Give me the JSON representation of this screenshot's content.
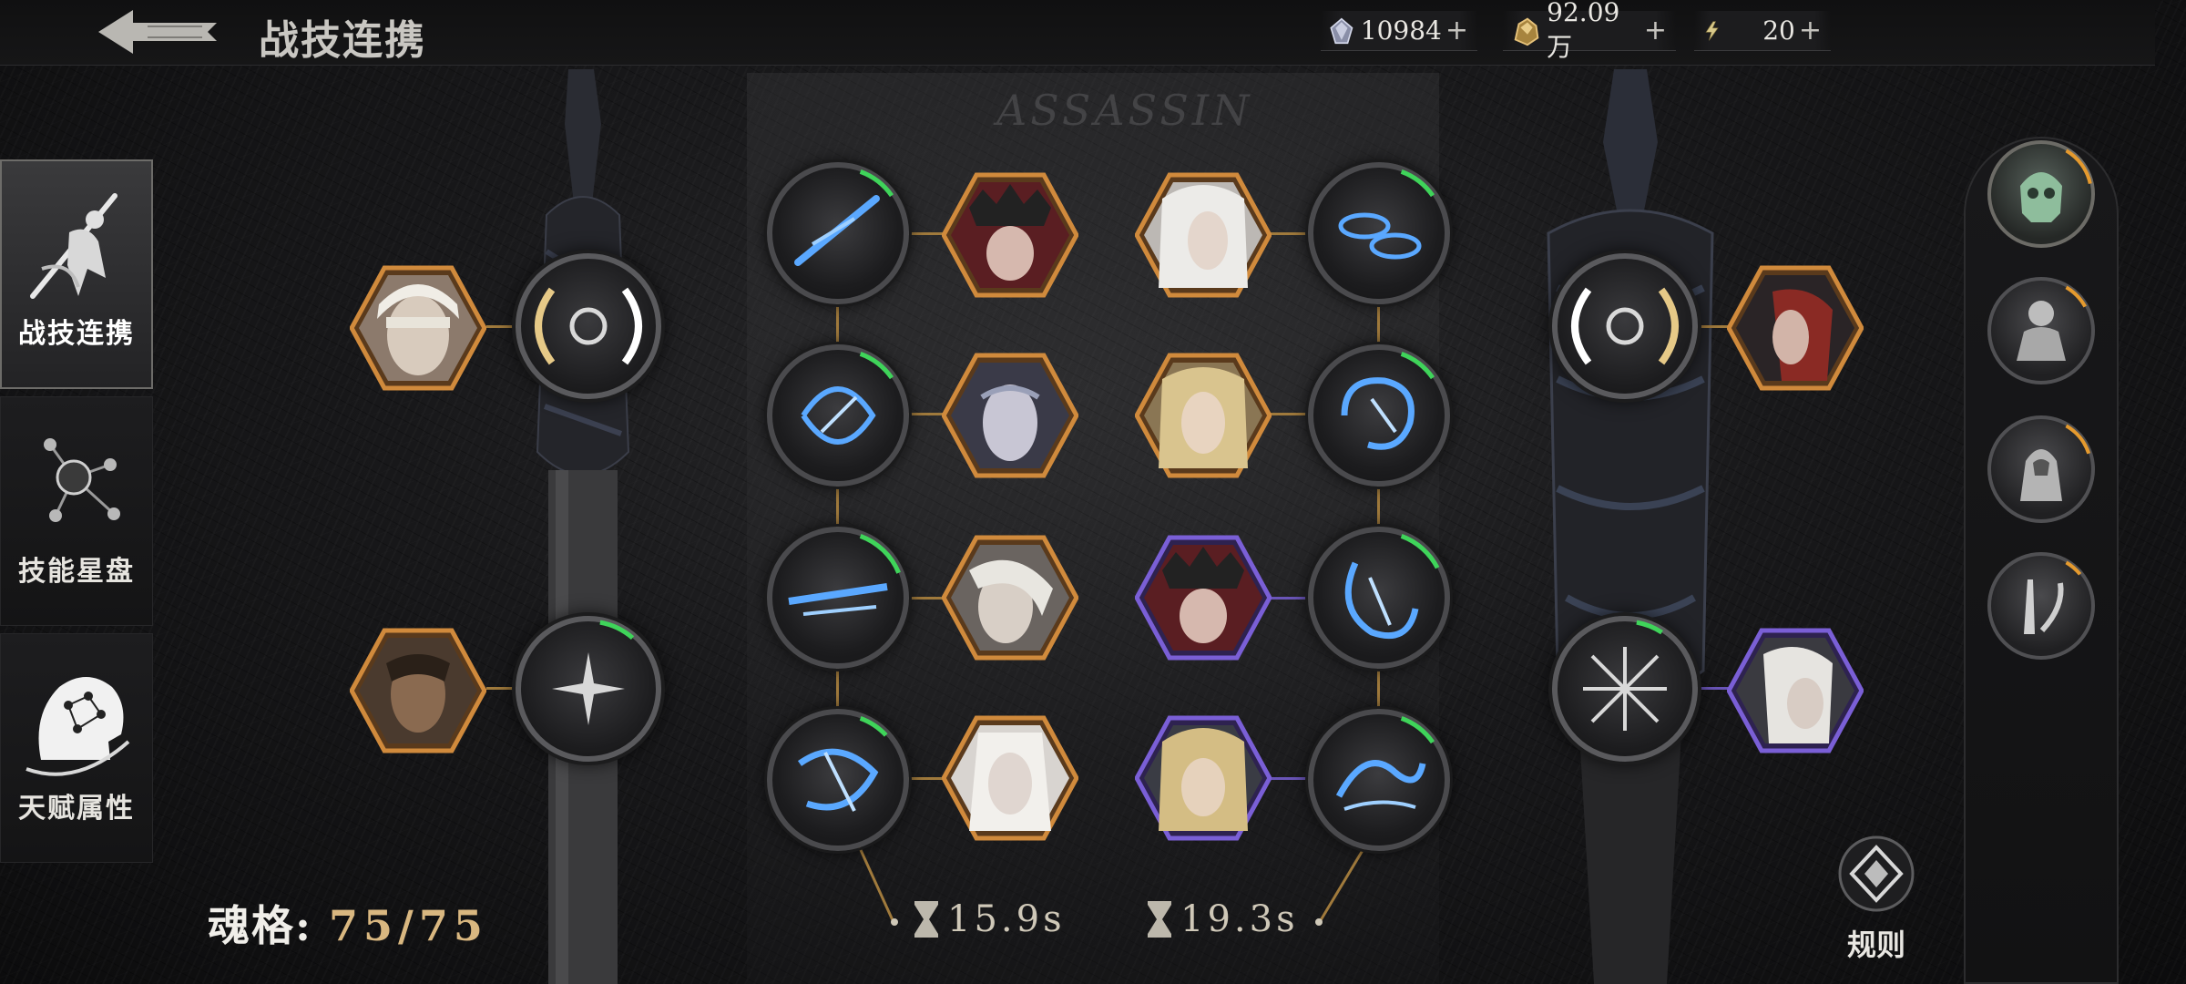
{
  "header": {
    "title": "战技连携",
    "currencies": [
      {
        "icon": "crystal-icon",
        "value": "10984",
        "plus": "+"
      },
      {
        "icon": "gold-ore-icon",
        "value": "92.09万",
        "plus": "+"
      },
      {
        "icon": "lightning-stamina-icon",
        "value": "20",
        "plus": "+"
      }
    ]
  },
  "sidebar": {
    "tabs": [
      {
        "label": "战技连携",
        "icon": "swordsman-icon",
        "active": true
      },
      {
        "label": "技能星盘",
        "icon": "constellation-icon",
        "active": false
      },
      {
        "label": "天赋属性",
        "icon": "head-profile-icon",
        "active": false
      }
    ]
  },
  "watermark": "ASSASSIN",
  "soul": {
    "label": "魂格:",
    "value": "75/75"
  },
  "timers": [
    {
      "icon": "hourglass-icon",
      "value": "15.9s"
    },
    {
      "icon": "hourglass-icon",
      "value": "19.3s"
    }
  ],
  "rules": {
    "label": "规则",
    "icon": "rules-diamond-icon"
  },
  "colors": {
    "gold_frame": "#c98a3a",
    "purple_frame": "#7a5fd6",
    "skill_blue": "#5aa8ff",
    "cooldown_green": "#3fd45a",
    "cooldown_orange": "#e59a2e"
  }
}
